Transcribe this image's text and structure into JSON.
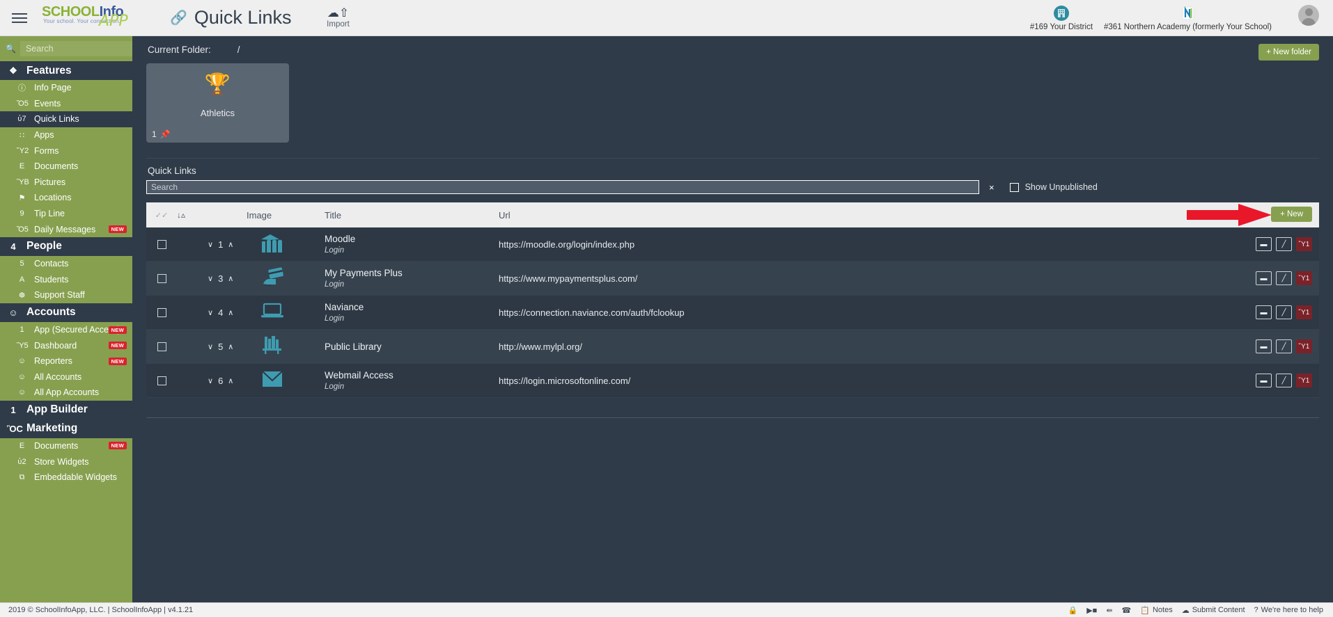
{
  "header": {
    "menu_icon": "hamburger-icon",
    "brand": {
      "school": "SCHOOL",
      "info": "Info",
      "tagline": "Your school. Your connection.",
      "app": "APP"
    },
    "page_title": "Quick Links",
    "page_icon": "link-icon",
    "import": {
      "label": "Import",
      "icon": "cloud-upload-icon"
    },
    "orgs": [
      {
        "name": "#169 Your District",
        "icon": "building-icon"
      },
      {
        "name": "#361 Northern Academy (formerly Your School)",
        "icon": "northern-academy-logo"
      }
    ],
    "avatar": "user-avatar"
  },
  "sidebar": {
    "search": {
      "placeholder": "Search",
      "value": "",
      "icon": "search-icon",
      "clear": "×"
    },
    "groups": [
      {
        "title": "Features",
        "icon": "cube-icon",
        "items": [
          {
            "label": "Info Page",
            "icon": "info-icon",
            "badge": "",
            "active": false
          },
          {
            "label": "Events",
            "icon": "calendar-icon",
            "badge": "",
            "active": false
          },
          {
            "label": "Quick Links",
            "icon": "link-icon",
            "badge": "",
            "active": true
          },
          {
            "label": "Apps",
            "icon": "grid-icon",
            "badge": "",
            "active": false
          },
          {
            "label": "Forms",
            "icon": "form-icon",
            "badge": "",
            "active": false
          },
          {
            "label": "Documents",
            "icon": "document-icon",
            "badge": "",
            "active": false
          },
          {
            "label": "Pictures",
            "icon": "image-icon",
            "badge": "",
            "active": false
          },
          {
            "label": "Locations",
            "icon": "map-pin-icon",
            "badge": "",
            "active": false
          },
          {
            "label": "Tip Line",
            "icon": "chat-icon",
            "badge": "",
            "active": false
          },
          {
            "label": "Daily Messages",
            "icon": "calendar-icon",
            "badge": "NEW",
            "active": false
          }
        ]
      },
      {
        "title": "People",
        "icon": "person-icon",
        "items": [
          {
            "label": "Contacts",
            "icon": "contacts-icon",
            "badge": "",
            "active": false
          },
          {
            "label": "Students",
            "icon": "students-icon",
            "badge": "",
            "active": false
          },
          {
            "label": "Support Staff",
            "icon": "lifering-icon",
            "badge": "",
            "active": false
          }
        ]
      },
      {
        "title": "Accounts",
        "icon": "group-icon",
        "items": [
          {
            "label": "App (Secured Access)",
            "icon": "mobile-icon",
            "badge": "NEW",
            "active": false
          },
          {
            "label": "Dashboard",
            "icon": "monitor-icon",
            "badge": "NEW",
            "active": false
          },
          {
            "label": "Reporters",
            "icon": "group-icon",
            "badge": "NEW",
            "active": false
          },
          {
            "label": "All Accounts",
            "icon": "group-icon",
            "badge": "",
            "active": false
          },
          {
            "label": "All App Accounts",
            "icon": "group-icon",
            "badge": "",
            "active": false
          }
        ]
      },
      {
        "title": "App Builder",
        "icon": "mobile-icon",
        "items": []
      },
      {
        "title": "Marketing",
        "icon": "briefcase-icon",
        "items": [
          {
            "label": "Documents",
            "icon": "document-icon",
            "badge": "NEW",
            "active": false
          },
          {
            "label": "Store Widgets",
            "icon": "lock-icon",
            "badge": "",
            "active": false
          },
          {
            "label": "Embeddable Widgets",
            "icon": "copy-icon",
            "badge": "",
            "active": false
          }
        ]
      }
    ]
  },
  "main": {
    "current_folder_label": "Current Folder:",
    "current_folder_value": "/",
    "new_folder_button": "+ New folder",
    "folders": [
      {
        "name": "Athletics",
        "icon": "trophy-icon",
        "count": "1",
        "pin_icon": "pin-icon"
      }
    ],
    "section_label": "Quick Links",
    "search": {
      "placeholder": "Search",
      "value": "",
      "clear": "×"
    },
    "show_unpublished": {
      "label": "Show Unpublished",
      "checked": false
    },
    "table": {
      "columns": [
        "",
        "",
        "Image",
        "Title",
        "Url"
      ],
      "sort_icon": "sort-ascending-icon",
      "select_all_icon": "check-all-icon",
      "new_button": "+ New",
      "rows": [
        {
          "order": "1",
          "image_icon": "moodle-logo",
          "title": "Moodle",
          "subtitle": "Login",
          "url": "https://moodle.org/login/index.php",
          "actions": [
            "folder-icon",
            "edit-icon",
            "delete-icon"
          ],
          "checked": false
        },
        {
          "order": "3",
          "image_icon": "payment-card-icon",
          "title": "My Payments Plus",
          "subtitle": "Login",
          "url": "https://www.mypaymentsplus.com/",
          "actions": [
            "folder-icon",
            "edit-icon",
            "delete-icon"
          ],
          "checked": false
        },
        {
          "order": "4",
          "image_icon": "laptop-icon",
          "title": "Naviance",
          "subtitle": "Login",
          "url": "https://connection.naviance.com/auth/fclookup",
          "actions": [
            "folder-icon",
            "edit-icon",
            "delete-icon"
          ],
          "checked": false
        },
        {
          "order": "5",
          "image_icon": "books-icon",
          "title": "Public Library",
          "subtitle": "",
          "url": "http://www.mylpl.org/",
          "actions": [
            "folder-icon",
            "edit-icon",
            "delete-icon"
          ],
          "checked": false
        },
        {
          "order": "6",
          "image_icon": "envelope-icon",
          "title": "Webmail Access",
          "subtitle": "Login",
          "url": "https://login.microsoftonline.com/",
          "actions": [
            "folder-icon",
            "edit-icon",
            "delete-icon"
          ],
          "checked": false
        }
      ]
    },
    "annotation": {
      "type": "red-arrow",
      "points_to": "+ New"
    }
  },
  "footer": {
    "copyright": "2019 © SchoolInfoApp, LLC. | SchoolInfoApp | v4.1.21",
    "icons": [
      "lock-icon",
      "video-icon",
      "share-icon",
      "phone-icon"
    ],
    "links": [
      {
        "label": "Notes",
        "icon": "notes-icon"
      },
      {
        "label": "Submit Content",
        "icon": "upload-icon"
      },
      {
        "label": "We're here to help",
        "icon": "question-icon"
      }
    ]
  },
  "colors": {
    "sidebar_green": "#87a04f",
    "accent_green": "#86a04f",
    "dark_panel": "#2f3b49",
    "teal_icon": "#3f9cb0",
    "badge_red": "#d9232d",
    "delete_red": "#7b2229",
    "arrow_red": "#e8172a"
  }
}
